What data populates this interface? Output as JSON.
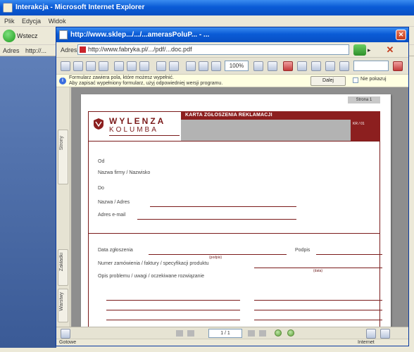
{
  "outer_window": {
    "title": "Interakcja - Microsoft Internet Explorer",
    "menu": [
      "Plik",
      "Edycja",
      "Widok"
    ],
    "back_label": "Wstecz",
    "address_label": "Adres",
    "address": "http://..."
  },
  "popup_window": {
    "title": "http://www.sklep.../.../...amerasPoluP...  - ...",
    "close_glyph": "✕",
    "nav_label": "Adres",
    "address": "http://www.fabryka.pl/.../pdf/...doc.pdf",
    "go_arrow": "▸",
    "message_icon": "i",
    "message_line1": "Formularz zawiera pola, które możesz wypełnić.",
    "message_line2": "Aby zapisać wypełniony formularz, użyj odpowiedniej wersji programu.",
    "message_button": "Dalej",
    "message_checkbox_label": "Nie pokazuj",
    "zoom": "100%",
    "side_tabs": [
      "Strony",
      "Zakładki",
      "Warstwy"
    ],
    "page_counter": "1 / 1",
    "status_left": "Gotowe",
    "status_right": "Internet"
  },
  "document": {
    "page_badge": "Strona 1",
    "logo_line1": "WYLENZA",
    "logo_line2": "KOLUMBA",
    "header_title": "KARTA ZGŁOSZENIA REKLAMACJI",
    "header_box_text": "KR / 01",
    "fields": {
      "label_a": "Od",
      "label_b": "Nazwa firmy / Nazwisko",
      "label_c": "Do",
      "label_d": "Nazwa / Adres",
      "label_e": "Adres e-mail",
      "label_f": "Data zgłoszenia",
      "label_g": "Podpis",
      "note_1": "(podpis)",
      "label_h": "Numer zamówienia / faktury / specyfikacji produktu",
      "note_2": "(data)",
      "label_i": "Opis problemu / uwagi / oczekiwane rozwiązanie"
    }
  },
  "colors": {
    "accent": "#8c1f1f",
    "titlebar": "#0a5bd6",
    "chrome": "#ece9d8"
  }
}
